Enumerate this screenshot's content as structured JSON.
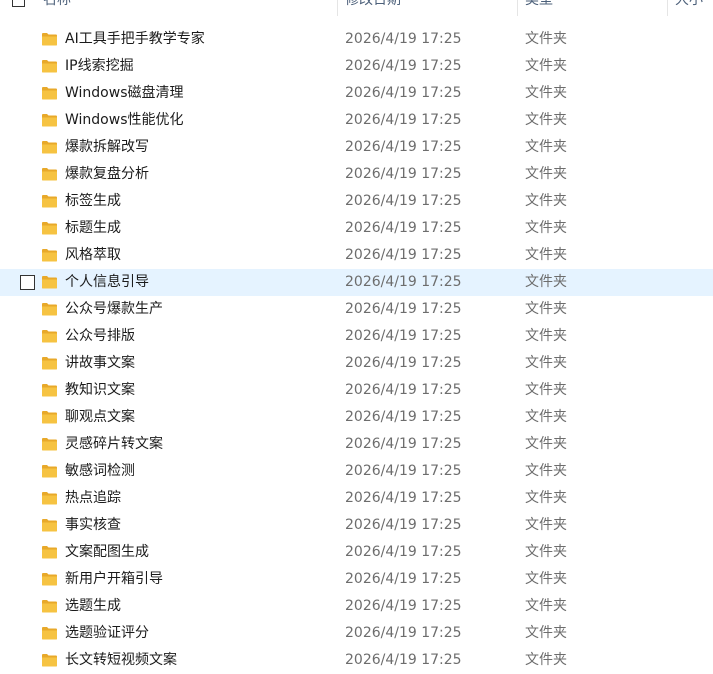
{
  "columns": {
    "name": "名称",
    "modified": "修改日期",
    "type": "类型",
    "size": "大小"
  },
  "icons": {
    "folder": "folder-icon",
    "checkbox": "checkbox-icon"
  },
  "colors": {
    "selected_row": "#e5f3ff",
    "folder": "#f6c342"
  },
  "rows": [
    {
      "name": "AI工具手把手教学专家",
      "date": "2026/4/19 17:25",
      "type": "文件夹"
    },
    {
      "name": "IP线索挖掘",
      "date": "2026/4/19 17:25",
      "type": "文件夹"
    },
    {
      "name": "Windows磁盘清理",
      "date": "2026/4/19 17:25",
      "type": "文件夹"
    },
    {
      "name": "Windows性能优化",
      "date": "2026/4/19 17:25",
      "type": "文件夹"
    },
    {
      "name": "爆款拆解改写",
      "date": "2026/4/19 17:25",
      "type": "文件夹"
    },
    {
      "name": "爆款复盘分析",
      "date": "2026/4/19 17:25",
      "type": "文件夹"
    },
    {
      "name": "标签生成",
      "date": "2026/4/19 17:25",
      "type": "文件夹"
    },
    {
      "name": "标题生成",
      "date": "2026/4/19 17:25",
      "type": "文件夹"
    },
    {
      "name": "风格萃取",
      "date": "2026/4/19 17:25",
      "type": "文件夹"
    },
    {
      "name": "个人信息引导",
      "date": "2026/4/19 17:25",
      "type": "文件夹",
      "selected": true
    },
    {
      "name": "公众号爆款生产",
      "date": "2026/4/19 17:25",
      "type": "文件夹"
    },
    {
      "name": "公众号排版",
      "date": "2026/4/19 17:25",
      "type": "文件夹"
    },
    {
      "name": "讲故事文案",
      "date": "2026/4/19 17:25",
      "type": "文件夹"
    },
    {
      "name": "教知识文案",
      "date": "2026/4/19 17:25",
      "type": "文件夹"
    },
    {
      "name": "聊观点文案",
      "date": "2026/4/19 17:25",
      "type": "文件夹"
    },
    {
      "name": "灵感碎片转文案",
      "date": "2026/4/19 17:25",
      "type": "文件夹"
    },
    {
      "name": "敏感词检测",
      "date": "2026/4/19 17:25",
      "type": "文件夹"
    },
    {
      "name": "热点追踪",
      "date": "2026/4/19 17:25",
      "type": "文件夹"
    },
    {
      "name": "事实核查",
      "date": "2026/4/19 17:25",
      "type": "文件夹"
    },
    {
      "name": "文案配图生成",
      "date": "2026/4/19 17:25",
      "type": "文件夹"
    },
    {
      "name": "新用户开箱引导",
      "date": "2026/4/19 17:25",
      "type": "文件夹"
    },
    {
      "name": "选题生成",
      "date": "2026/4/19 17:25",
      "type": "文件夹"
    },
    {
      "name": "选题验证评分",
      "date": "2026/4/19 17:25",
      "type": "文件夹"
    },
    {
      "name": "长文转短视频文案",
      "date": "2026/4/19 17:25",
      "type": "文件夹"
    }
  ]
}
